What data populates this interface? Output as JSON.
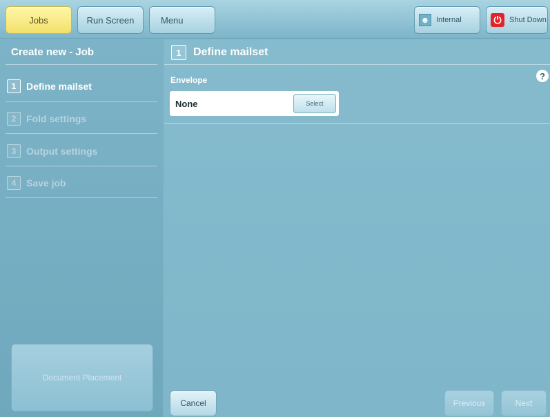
{
  "topbar": {
    "jobs_label": "Jobs",
    "run_screen_label": "Run Screen",
    "menu_label": "Menu",
    "internal_label": "Internal",
    "shutdown_label": "Shut Down"
  },
  "sidebar": {
    "title": "Create new - Job",
    "steps": [
      {
        "num": "1",
        "label": "Define mailset"
      },
      {
        "num": "2",
        "label": "Fold settings"
      },
      {
        "num": "3",
        "label": "Output settings"
      },
      {
        "num": "4",
        "label": "Save job"
      }
    ],
    "document_placement_label": "Document Placement"
  },
  "main": {
    "step_num": "1",
    "title": "Define mailset",
    "help_label": "?",
    "envelope_label": "Envelope",
    "envelope_value": "None",
    "select_label": "Select"
  },
  "footer": {
    "cancel_label": "Cancel",
    "previous_label": "Previous",
    "next_label": "Next"
  },
  "colors": {
    "accent_active": "#f2e06a",
    "panel": "#7fb6c9",
    "power": "#e3232a"
  },
  "icons": {
    "internal": "user-icon",
    "shutdown": "power-icon"
  }
}
